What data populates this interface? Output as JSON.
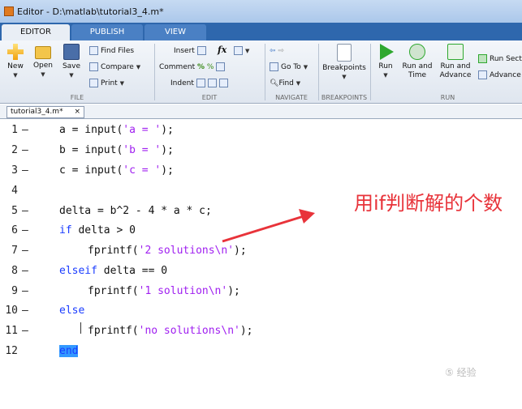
{
  "window": {
    "title": "Editor - D:\\matlab\\tutorial3_4.m*"
  },
  "tabs": [
    {
      "label": "EDITOR",
      "active": true
    },
    {
      "label": "PUBLISH",
      "active": false
    },
    {
      "label": "VIEW",
      "active": false
    }
  ],
  "ribbon": {
    "file": {
      "group_label": "FILE",
      "new": "New",
      "open": "Open",
      "save": "Save",
      "find_files": "Find Files",
      "compare": "Compare",
      "print": "Print"
    },
    "edit": {
      "group_label": "EDIT",
      "insert": "Insert",
      "comment": "Comment",
      "indent": "Indent",
      "fx": "fx"
    },
    "navigate": {
      "group_label": "NAVIGATE",
      "go_to": "Go To",
      "find": "Find"
    },
    "breakpoints": {
      "group_label": "BREAKPOINTS",
      "breakpoints": "Breakpoints"
    },
    "run": {
      "group_label": "RUN",
      "run": "Run",
      "run_and_time_1": "Run and",
      "run_and_time_2": "Time",
      "run_and_advance_1": "Run and",
      "run_and_advance_2": "Advance",
      "run_section": "Run Secti",
      "advance": "Advance"
    }
  },
  "file_tab": {
    "name": "tutorial3_4.m*",
    "close": "×"
  },
  "code": {
    "line_numbers": [
      "1",
      "2",
      "3",
      "4",
      "5",
      "6",
      "7",
      "8",
      "9",
      "10",
      "11",
      "12"
    ],
    "marker": "—",
    "l1a": "a = input(",
    "l1s": "'a = '",
    "l1b": ");",
    "l2a": "b = input(",
    "l2s": "'b = '",
    "l2b": ");",
    "l3a": "c = input(",
    "l3s": "'c = '",
    "l3b": ");",
    "l5": "delta = b^2 - 4 * a * c;",
    "l6k": "if",
    "l6r": " delta > 0",
    "l7a": "fprintf(",
    "l7s": "'2 solutions\\n'",
    "l7b": ");",
    "l8k": "elseif",
    "l8r": " delta == 0",
    "l9a": "fprintf(",
    "l9s": "'1 solution\\n'",
    "l9b": ");",
    "l10k": "else",
    "l11a": "fprintf(",
    "l11s": "'no solutions\\n'",
    "l11b": ");",
    "l12k": "end"
  },
  "annotation": {
    "text": "用if判断解的个数"
  },
  "watermark": {
    "text": "⑤ 经验"
  },
  "colors": {
    "keyword": "#1a3cff",
    "string": "#a020f0",
    "annotation": "#e8333a",
    "selection": "#3399ff"
  }
}
